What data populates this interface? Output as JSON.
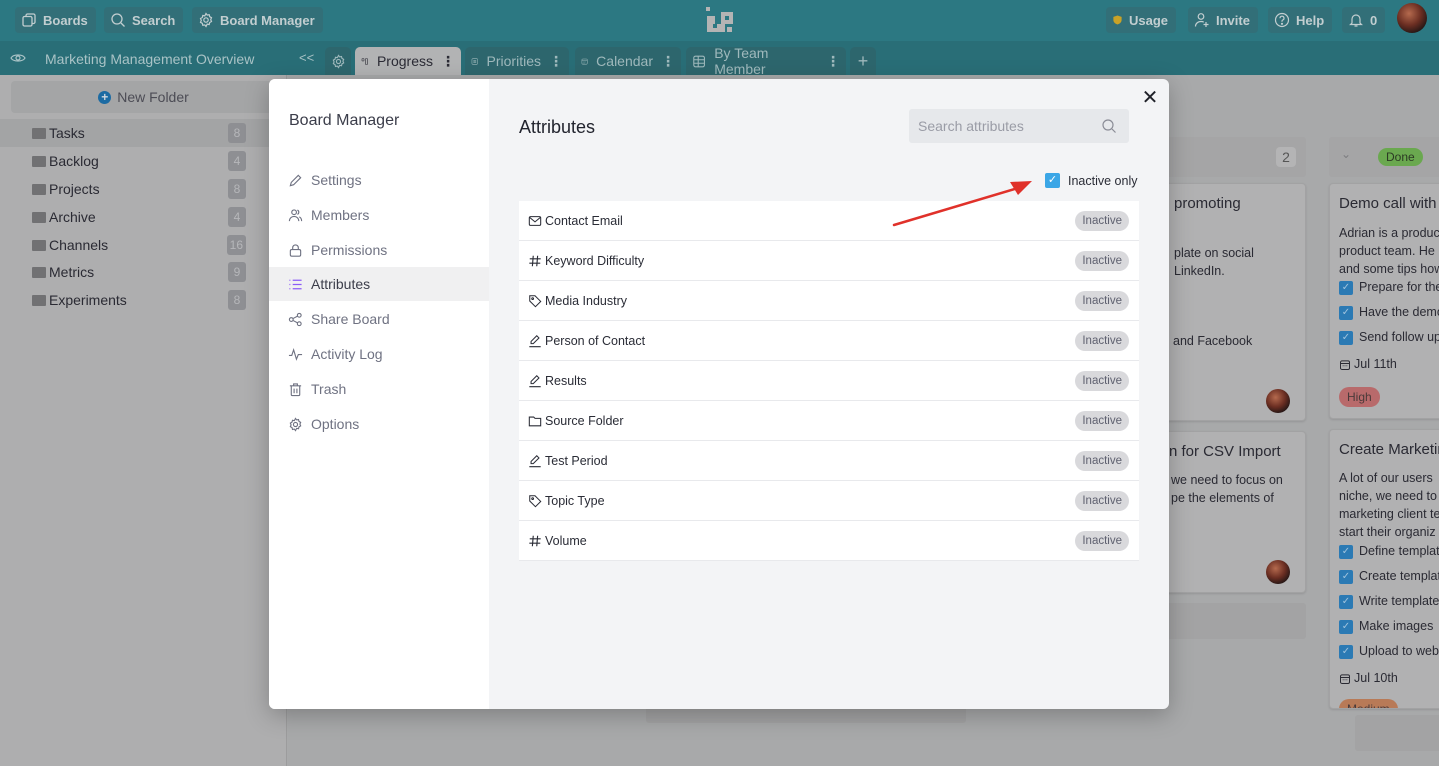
{
  "topbar": {
    "boards_label": "Boards",
    "search_label": "Search",
    "board_manager_label": "Board Manager",
    "usage_label": "Usage",
    "invite_label": "Invite",
    "help_label": "Help",
    "notifications_count": "0"
  },
  "tabbar": {
    "board_title": "Marketing Management Overview",
    "collapse_glyph": "<<",
    "tabs": [
      {
        "label": "Progress",
        "icon": "kanban-icon",
        "active": true
      },
      {
        "label": "Priorities",
        "icon": "list-icon",
        "active": false
      },
      {
        "label": "Calendar",
        "icon": "calendar-icon",
        "active": false
      },
      {
        "label": "By Team Member",
        "icon": "table-icon",
        "active": false
      }
    ],
    "add_tab_glyph": "+"
  },
  "sidebar": {
    "new_folder_label": "New Folder",
    "folders": [
      {
        "name": "Tasks",
        "count": "8",
        "selected": true
      },
      {
        "name": "Backlog",
        "count": "4"
      },
      {
        "name": "Projects",
        "count": "8"
      },
      {
        "name": "Archive",
        "count": "4"
      },
      {
        "name": "Channels",
        "count": "16"
      },
      {
        "name": "Metrics",
        "count": "9"
      },
      {
        "name": "Experiments",
        "count": "8"
      }
    ]
  },
  "board": {
    "column_1": {
      "count": "2",
      "card_1": {
        "title_fragment": "promoting",
        "text_lines": [
          "plate on social",
          "LinkedIn."
        ],
        "text_line_3": "and Facebook"
      },
      "card_2": {
        "title_fragment": "n for CSV Import",
        "text_lines": [
          "we need to focus on",
          "pe the elements of"
        ]
      }
    },
    "column_2": {
      "status_label": "Done",
      "status_color": "#6aa84f",
      "card_1": {
        "title": "Demo call with ...",
        "text_lines": [
          "Adrian is a produc",
          "product team. He",
          "and some tips how"
        ],
        "checklist": [
          "Prepare for the",
          "Have the demo",
          "Send follow up"
        ],
        "date": "Jul 11th",
        "priority": "High",
        "priority_color": "#b86a6b"
      },
      "card_2": {
        "title": "Create Marketin",
        "text_lines": [
          "A lot of our users",
          "niche, we need to",
          "marketing client te",
          "start their organiz"
        ],
        "checklist": [
          "Define templat",
          "Create templat",
          "Write template",
          "Make images",
          "Upload to web"
        ],
        "date": "Jul 10th",
        "priority": "Medium",
        "priority_color": "#b87a57"
      }
    }
  },
  "modal": {
    "nav_title": "Board Manager",
    "nav_items": [
      {
        "label": "Settings",
        "icon": "pencil-icon"
      },
      {
        "label": "Members",
        "icon": "members-icon"
      },
      {
        "label": "Permissions",
        "icon": "lock-icon"
      },
      {
        "label": "Attributes",
        "icon": "list-icon",
        "active": true
      },
      {
        "label": "Share Board",
        "icon": "share-icon"
      },
      {
        "label": "Activity Log",
        "icon": "activity-icon"
      },
      {
        "label": "Trash",
        "icon": "trash-icon"
      },
      {
        "label": "Options",
        "icon": "gear-icon"
      }
    ],
    "title": "Attributes",
    "close_glyph": "✕",
    "search_placeholder": "Search attributes",
    "search_value": "",
    "inactive_only_label": "Inactive only",
    "inactive_only_checked": true,
    "attributes": [
      {
        "name": "Contact Email",
        "type_icon": "email-icon",
        "status": "Inactive"
      },
      {
        "name": "Keyword Difficulty",
        "type_icon": "hash-icon",
        "status": "Inactive"
      },
      {
        "name": "Media Industry",
        "type_icon": "tag-icon",
        "status": "Inactive"
      },
      {
        "name": "Person of Contact",
        "type_icon": "text-icon",
        "status": "Inactive"
      },
      {
        "name": "Results",
        "type_icon": "text-icon",
        "status": "Inactive"
      },
      {
        "name": "Source Folder",
        "type_icon": "folder-icon",
        "status": "Inactive"
      },
      {
        "name": "Test Period",
        "type_icon": "text-icon",
        "status": "Inactive"
      },
      {
        "name": "Topic Type",
        "type_icon": "tag-icon",
        "status": "Inactive"
      },
      {
        "name": "Volume",
        "type_icon": "hash-icon",
        "status": "Inactive"
      }
    ]
  },
  "colors": {
    "topbar": "#2c7882",
    "accent_checkbox": "#3ba6e6",
    "annotation_arrow": "#e0312a",
    "usage_shield": "#c9a227"
  }
}
